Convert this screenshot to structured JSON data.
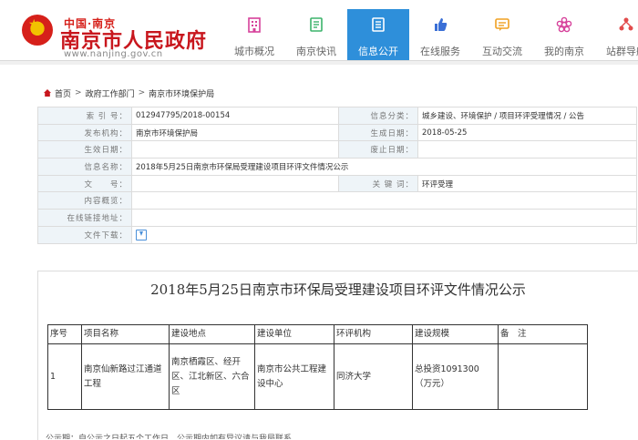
{
  "header": {
    "logo_sub": "中国·南京",
    "logo_title": "南京市人民政府",
    "logo_url": "www.nanjing.gov.cn"
  },
  "nav": {
    "items": [
      {
        "label": "城市概况",
        "icon": "building-icon"
      },
      {
        "label": "南京快讯",
        "icon": "news-icon"
      },
      {
        "label": "信息公开",
        "icon": "document-icon",
        "active": true
      },
      {
        "label": "在线服务",
        "icon": "thumbs-up-icon"
      },
      {
        "label": "互动交流",
        "icon": "chat-icon"
      },
      {
        "label": "我的南京",
        "icon": "flower-icon"
      },
      {
        "label": "站群导航",
        "icon": "sitemap-icon"
      }
    ]
  },
  "breadcrumb": {
    "home": "首页",
    "level1": "政府工作部门",
    "level2": "南京市环境保护局"
  },
  "meta": {
    "index_label": "索 引 号：",
    "index_value": "012947795/2018-00154",
    "category_label": "信息分类：",
    "category_value": "城乡建设、环境保护 / 项目环评受理情况 / 公告",
    "publisher_label": "发布机构：",
    "publisher_value": "南京市环境保护局",
    "gen_date_label": "生成日期：",
    "gen_date_value": "2018-05-25",
    "effective_label": "生效日期：",
    "abolish_label": "废止日期：",
    "info_name_label": "信息名称：",
    "info_name_value": "2018年5月25日南京市环保局受理建设项目环评文件情况公示",
    "doc_no_label": "文　　号：",
    "keywords_label": "关 键 词：",
    "keywords_value": "环评受理",
    "overview_label": "内容概览：",
    "link_label": "在线链接地址：",
    "download_label": "文件下载："
  },
  "article": {
    "title": "2018年5月25日南京市环保局受理建设项目环评文件情况公示",
    "headers": [
      "序号",
      "项目名称",
      "建设地点",
      "建设单位",
      "环评机构",
      "建设规模",
      "备　注"
    ],
    "rows": [
      [
        "1",
        "南京仙新路过江通道工程",
        "南京栖霞区、经开区、江北新区、六合区",
        "南京市公共工程建设中心",
        "同济大学",
        "总投资1091300（万元）",
        ""
      ]
    ],
    "footer_fragment": "公示期：自公示之日起五个工作日，公示期内如有异议请与我局联系"
  },
  "colors": {
    "brand_red": "#c8161d",
    "nav_active": "#2e8fda",
    "label_bg": "#eef4f8"
  }
}
